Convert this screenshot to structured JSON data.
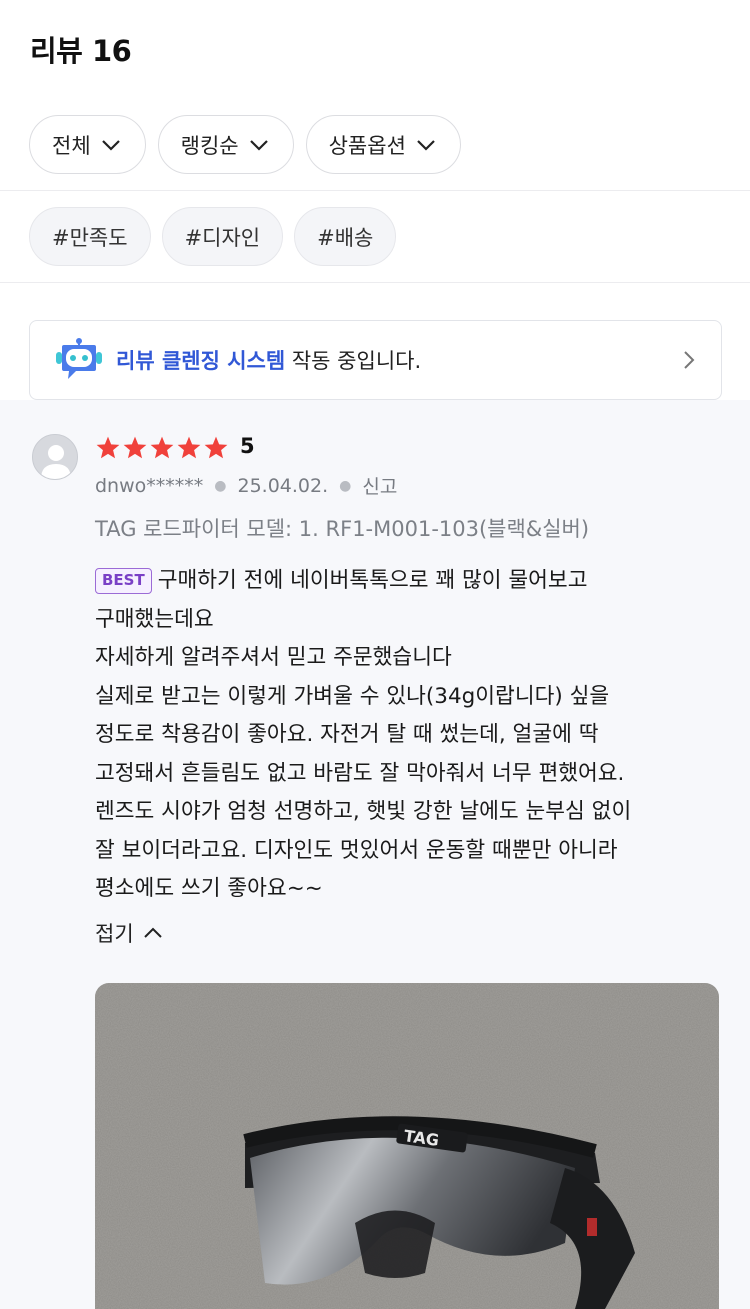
{
  "header": {
    "title": "리뷰 16"
  },
  "filters": [
    {
      "label": "전체"
    },
    {
      "label": "랭킹순"
    },
    {
      "label": "상품옵션"
    }
  ],
  "tags": [
    {
      "label": "#만족도"
    },
    {
      "label": "#디자인"
    },
    {
      "label": "#배송"
    }
  ],
  "cleansing": {
    "highlight": "리뷰 클렌징 시스템",
    "text": " 작동 중입니다."
  },
  "review": {
    "rating": "5",
    "stars": 5,
    "user": "dnwo******",
    "date": "25.04.02.",
    "report": "신고",
    "option": "TAG 로드파이터 모델: 1. RF1-M001-103(블랙&실버)",
    "badge": "BEST",
    "lines": [
      "구매하기 전에 네이버톡톡으로 꽤 많이 물어보고",
      "구매했는데요",
      "자세하게 알려주셔서 믿고 주문했습니다",
      "실제로 받고는 이렇게 가벼울 수 있나(34g이랍니다) 싶을",
      "정도로 착용감이 좋아요. 자전거 탈 때 썼는데, 얼굴에 딱",
      "고정돼서 흔들림도 없고 바람도 잘 막아줘서 너무 편했어요.",
      "렌즈도 시야가 엄청 선명하고, 햇빛 강한 날에도 눈부심 없이",
      "잘 보이더라고요. 디자인도 멋있어서 운동할 때뿐만 아니라",
      "평소에도 쓰기 좋아요~~"
    ],
    "fold_label": "접기",
    "photo_brand": "TAG"
  },
  "colors": {
    "accent": "#3158d6",
    "star": "#f0413b",
    "badge": "#7a3fc6"
  }
}
